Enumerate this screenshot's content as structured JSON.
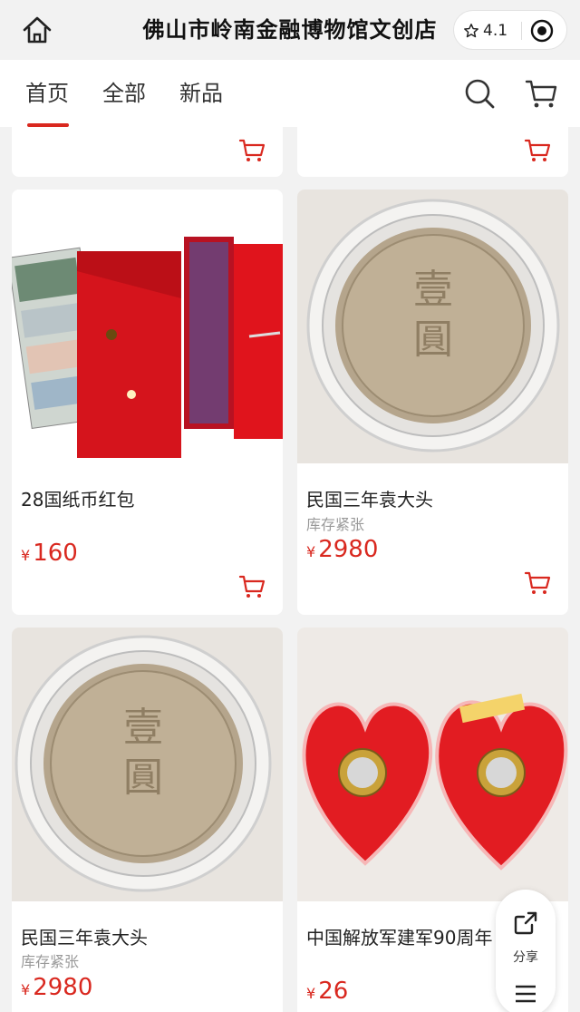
{
  "header": {
    "title": "佛山市岭南金融博物馆文创店",
    "rating": "4.1"
  },
  "nav": {
    "tabs": [
      {
        "label": "首页",
        "active": true
      },
      {
        "label": "全部",
        "active": false
      },
      {
        "label": "新品",
        "active": false
      }
    ]
  },
  "products": [
    {
      "name": "28国纸币红包",
      "sub": "",
      "currency": "¥",
      "price": "160",
      "image": "red-envelope-with-banknotes"
    },
    {
      "name": "民国三年袁大头",
      "sub": "库存紧张",
      "currency": "¥",
      "price": "2980",
      "image": "silver-dollar-coin"
    },
    {
      "name": "民国三年袁大头",
      "sub": "库存紧张",
      "currency": "¥",
      "price": "2980",
      "image": "silver-dollar-coin"
    },
    {
      "name": "中国解放军建军90周年",
      "sub": "",
      "currency": "¥",
      "price": "26",
      "image": "commemorative-coins-heart-case"
    }
  ],
  "float": {
    "share_label": "分享"
  },
  "colors": {
    "accent": "#d9281f",
    "background": "#f2f2f2"
  }
}
